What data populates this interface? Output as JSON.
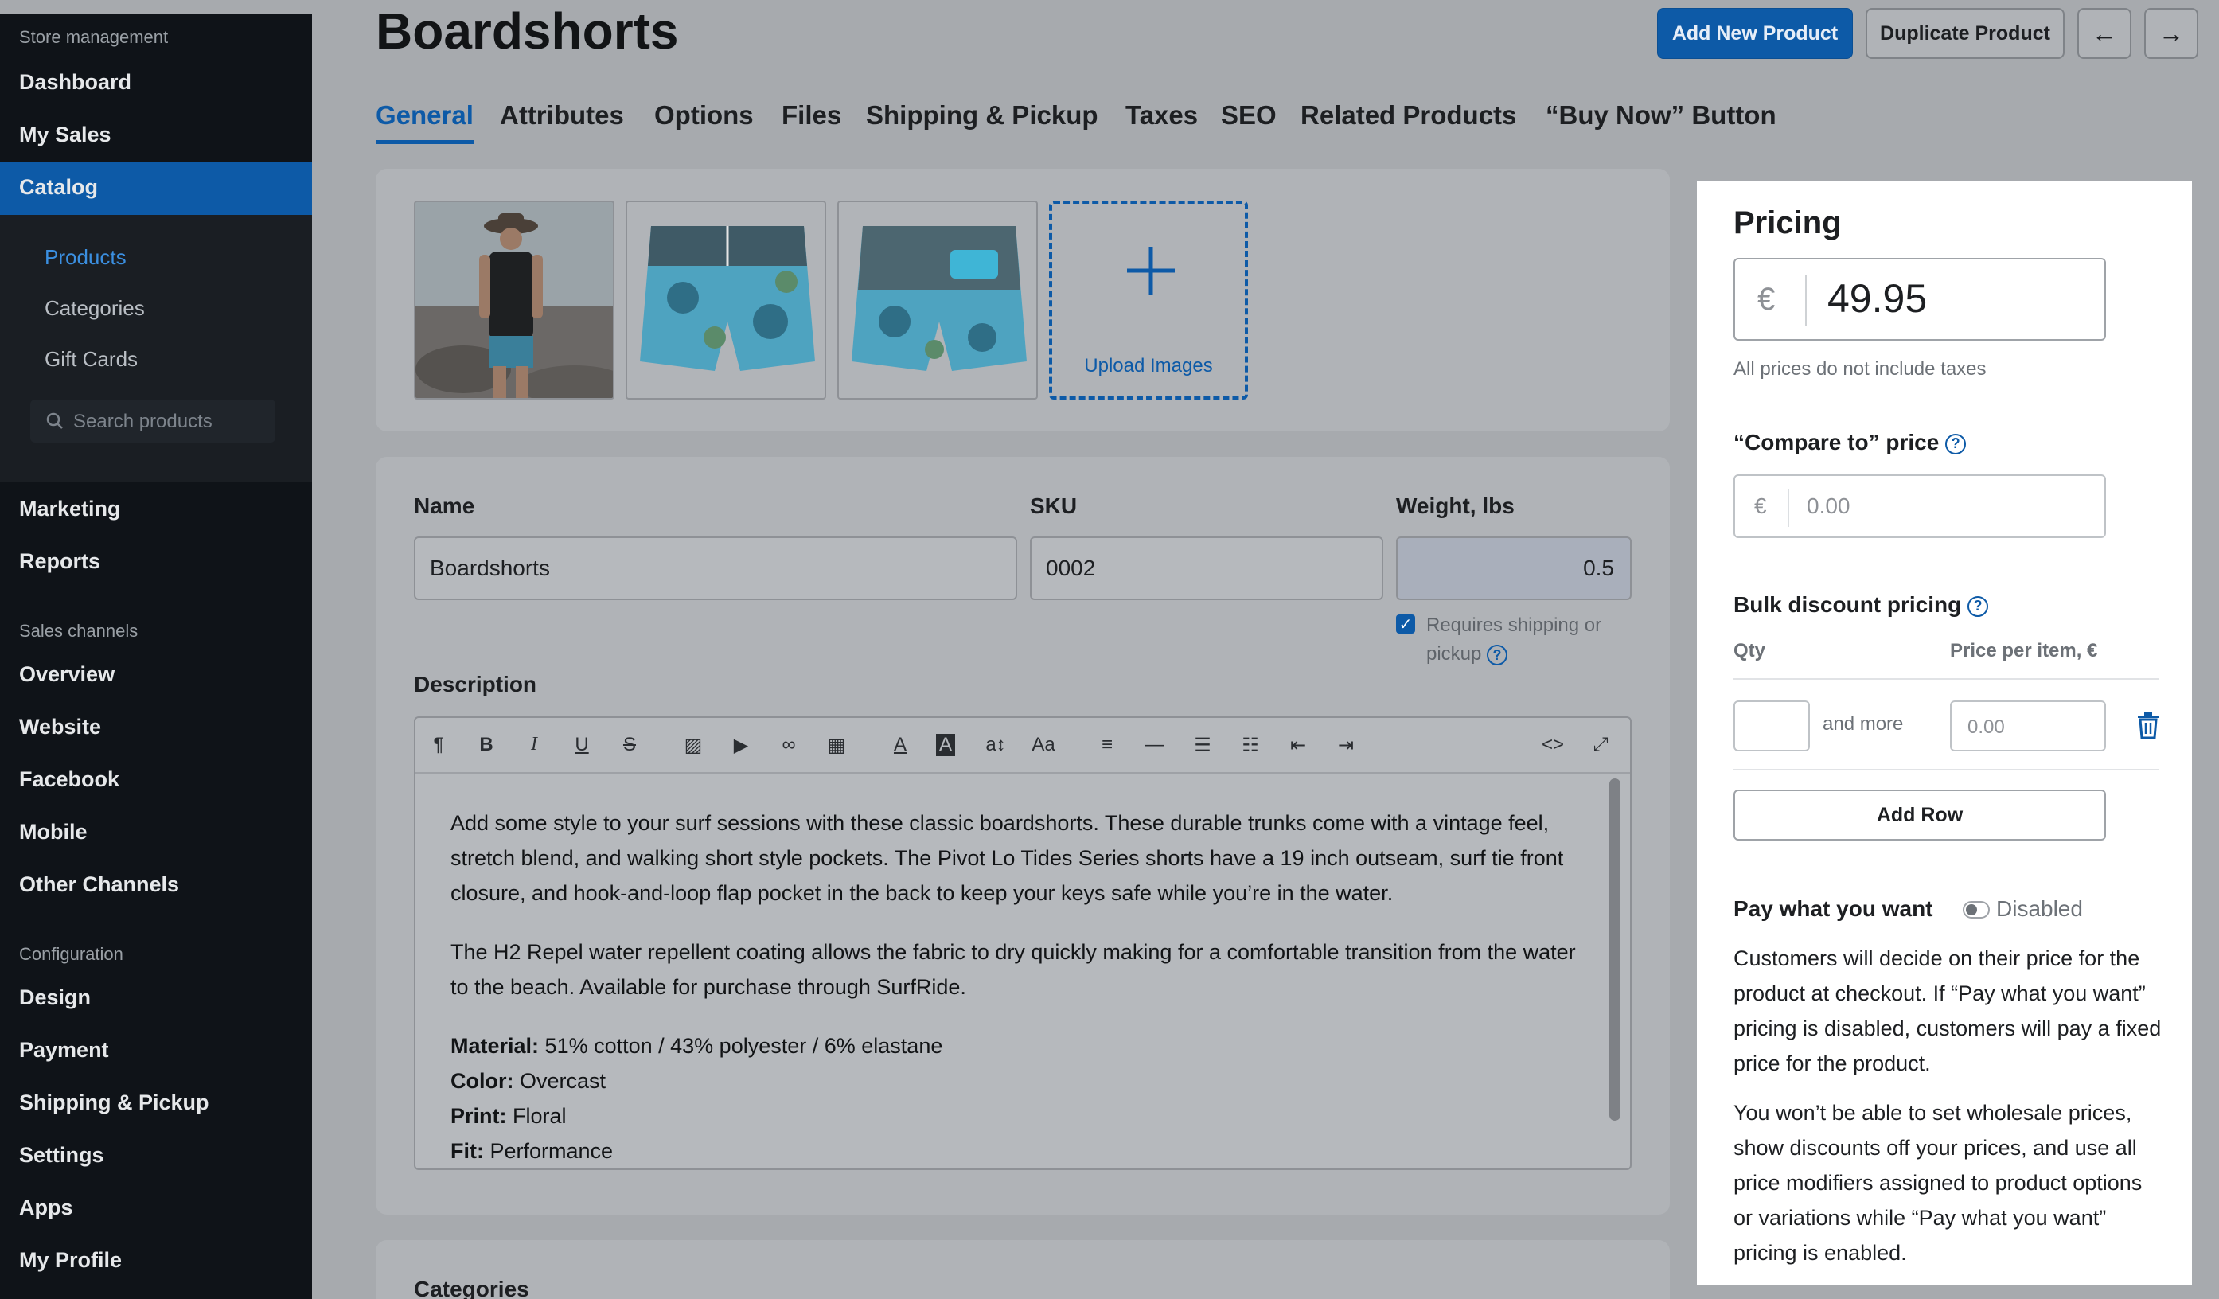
{
  "sidebar": {
    "section_store": "Store management",
    "items_top": [
      "Dashboard",
      "My Sales",
      "Catalog"
    ],
    "catalog_sub": [
      "Products",
      "Categories",
      "Gift Cards"
    ],
    "search_placeholder": "Search products",
    "items_mid": [
      "Marketing",
      "Reports"
    ],
    "section_channels": "Sales channels",
    "channels": [
      "Overview",
      "Website",
      "Facebook",
      "Mobile",
      "Other Channels"
    ],
    "section_config": "Configuration",
    "config": [
      "Design",
      "Payment",
      "Shipping & Pickup",
      "Settings",
      "Apps",
      "My Profile"
    ]
  },
  "header": {
    "title": "Boardshorts",
    "add_new": "Add New Product",
    "duplicate": "Duplicate Product",
    "prev_arrow": "←",
    "next_arrow": "→"
  },
  "tabs": [
    "General",
    "Attributes",
    "Options",
    "Files",
    "Shipping & Pickup",
    "Taxes",
    "SEO",
    "Related Products",
    "“Buy Now” Button"
  ],
  "media": {
    "upload_label": "Upload Images"
  },
  "product": {
    "name_label": "Name",
    "name_value": "Boardshorts",
    "sku_label": "SKU",
    "sku_value": "0002",
    "weight_label": "Weight, lbs",
    "weight_value": "0.5",
    "requires_shipping": "Requires shipping or pickup",
    "description_label": "Description",
    "description_p1": "Add some style to your surf sessions with these classic boardshorts. These durable trunks come with a vintage feel, stretch blend, and walking short style pockets. The Pivot Lo Tides Series shorts have a 19 inch outseam, surf tie front closure, and hook-and-loop flap pocket in the back to keep your keys safe while you’re in the water.",
    "description_p2": "The H2 Repel water repellent coating allows the fabric to dry quickly making for a comfortable transition from the water to the beach. Available for purchase through SurfRide.",
    "specs": [
      {
        "k": "Material:",
        "v": " 51% cotton / 43% polyester / 6% elastane"
      },
      {
        "k": "Color:",
        "v": " Overcast"
      },
      {
        "k": "Print:",
        "v": " Floral"
      },
      {
        "k": "Fit:",
        "v": " Performance"
      }
    ],
    "categories_label": "Categories"
  },
  "pricing": {
    "title": "Pricing",
    "currency": "€",
    "price": "49.95",
    "note": "All prices do not include taxes",
    "compare_label": "“Compare to” price",
    "compare_placeholder": "0.00",
    "bulk_label": "Bulk discount pricing",
    "qty_header": "Qty",
    "ppi_header": "Price per item, €",
    "and_more": "and more",
    "ppi_placeholder": "0.00",
    "add_row": "Add Row",
    "pwyw_label": "Pay what you want",
    "pwyw_state": "Disabled",
    "pwyw_p1": "Customers will decide on their price for the product at checkout. If “Pay what you want” pricing is disabled, customers will pay a fixed price for the product.",
    "pwyw_p2": "You won’t be able to set wholesale prices, show discounts off your prices, and use all price modifiers assigned to product options or variations while “Pay what you want” pricing is enabled."
  }
}
